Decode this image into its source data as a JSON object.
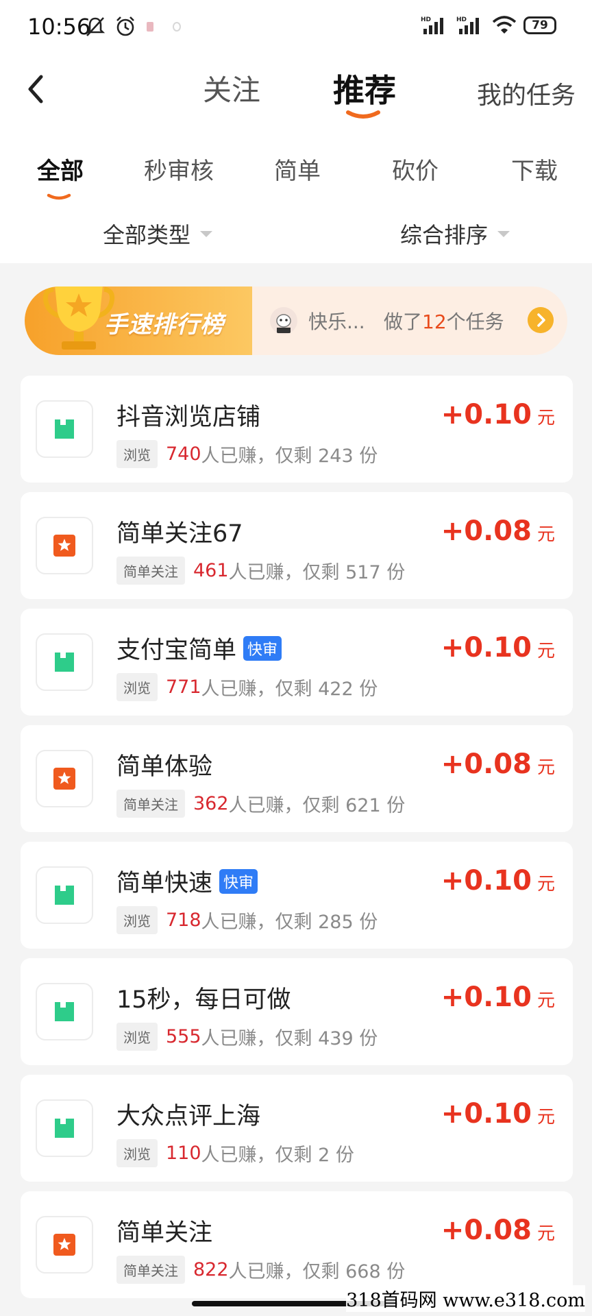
{
  "status_bar": {
    "time": "10:56",
    "battery": "79"
  },
  "header": {
    "tabs": [
      {
        "label": "关注",
        "active": false
      },
      {
        "label": "推荐",
        "active": true
      }
    ],
    "my_tasks": "我的任务"
  },
  "categories": [
    {
      "label": "全部",
      "active": true
    },
    {
      "label": "秒审核",
      "active": false
    },
    {
      "label": "简单",
      "active": false
    },
    {
      "label": "砍价",
      "active": false
    },
    {
      "label": "下载",
      "active": false
    }
  ],
  "filters": {
    "type": "全部类型",
    "sort": "综合排序"
  },
  "leaderboard": {
    "title": "手速排行榜",
    "user": "快乐...",
    "desc_prefix": "做了",
    "count": "12",
    "desc_suffix": "个任务"
  },
  "colors": {
    "accent": "#F06A1E",
    "price": "#E8331F",
    "earned": "#D8282F",
    "browse_icon": "#2ECC8A",
    "follow_icon": "#F05A1E",
    "fast_badge": "#2F7CF6"
  },
  "tasks": [
    {
      "title": "抖音浏览店铺",
      "fast": "",
      "tag": "浏览",
      "icon": "bookmark-icon",
      "earned": "740",
      "text": "人已赚，仅剩 243 份",
      "reward": "+0.10",
      "unit": "元"
    },
    {
      "title": "简单关注67",
      "fast": "",
      "tag": "简单关注",
      "icon": "star-icon",
      "earned": "461",
      "text": "人已赚，仅剩 517 份",
      "reward": "+0.08",
      "unit": "元"
    },
    {
      "title": "支付宝简单",
      "fast": "快审",
      "tag": "浏览",
      "icon": "bookmark-icon",
      "earned": "771",
      "text": "人已赚，仅剩 422 份",
      "reward": "+0.10",
      "unit": "元"
    },
    {
      "title": "简单体验",
      "fast": "",
      "tag": "简单关注",
      "icon": "star-icon",
      "earned": "362",
      "text": "人已赚，仅剩 621 份",
      "reward": "+0.08",
      "unit": "元"
    },
    {
      "title": "简单快速",
      "fast": "快审",
      "tag": "浏览",
      "icon": "bookmark-icon",
      "earned": "718",
      "text": "人已赚，仅剩 285 份",
      "reward": "+0.10",
      "unit": "元"
    },
    {
      "title": "15秒，每日可做",
      "fast": "",
      "tag": "浏览",
      "icon": "bookmark-icon",
      "earned": "555",
      "text": "人已赚，仅剩 439 份",
      "reward": "+0.10",
      "unit": "元"
    },
    {
      "title": "大众点评上海",
      "fast": "",
      "tag": "浏览",
      "icon": "bookmark-icon",
      "earned": "110",
      "text": "人已赚，仅剩 2 份",
      "reward": "+0.10",
      "unit": "元"
    },
    {
      "title": "简单关注",
      "fast": "",
      "tag": "简单关注",
      "icon": "star-icon",
      "earned": "822",
      "text": "人已赚，仅剩 668 份",
      "reward": "+0.08",
      "unit": "元"
    }
  ],
  "watermark": "318首码网  www.e318.com"
}
